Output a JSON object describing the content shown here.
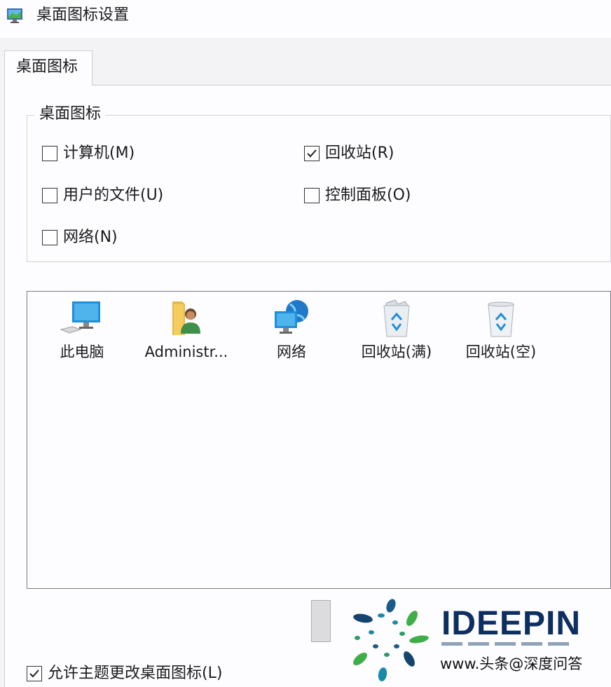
{
  "window": {
    "title": "桌面图标设置",
    "icon": "display-settings-icon"
  },
  "tabs": [
    {
      "label": "桌面图标",
      "selected": true
    }
  ],
  "group": {
    "legend": "桌面图标",
    "checkboxes": [
      {
        "label": "计算机(M)",
        "checked": false
      },
      {
        "label": "回收站(R)",
        "checked": true
      },
      {
        "label": "用户的文件(U)",
        "checked": false
      },
      {
        "label": "控制面板(O)",
        "checked": false
      },
      {
        "label": "网络(N)",
        "checked": false
      }
    ]
  },
  "icons": [
    {
      "label": "此电脑",
      "icon": "computer-icon"
    },
    {
      "label": "Administr...",
      "icon": "user-folder-icon"
    },
    {
      "label": "网络",
      "icon": "network-icon"
    },
    {
      "label": "回收站(满)",
      "icon": "recycle-bin-full-icon"
    },
    {
      "label": "回收站(空)",
      "icon": "recycle-bin-empty-icon"
    }
  ],
  "allow_theme": {
    "label": "允许主题更改桌面图标(L)",
    "checked": true
  },
  "watermark": {
    "brand": "IDEEPIN",
    "credit": "www.头条@深度问答"
  },
  "colors": {
    "window_bg": "#fdfcff",
    "border": "#7a7a7f",
    "brand": "#0d2e60",
    "teal": "#1a8aa8",
    "green": "#3fae49"
  }
}
